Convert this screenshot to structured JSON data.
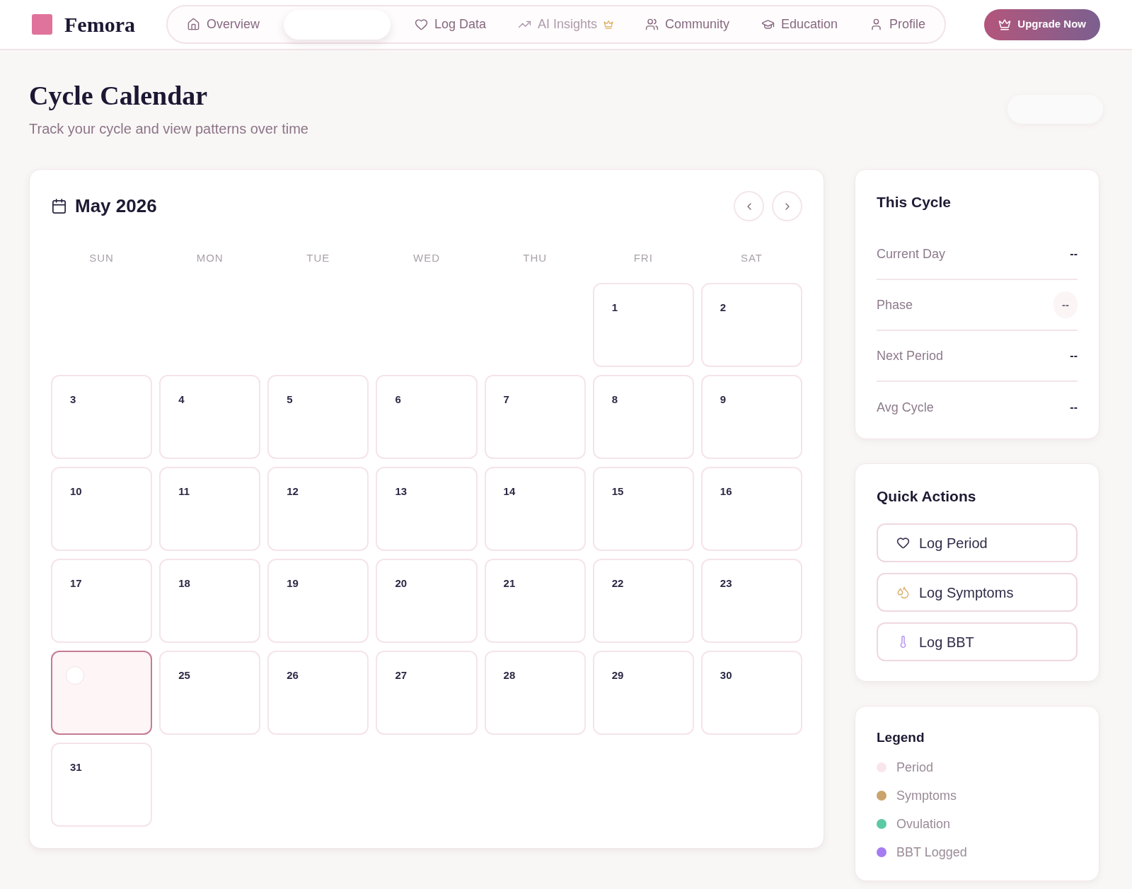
{
  "nav": {
    "logo": "Femora",
    "items": [
      {
        "label": "Overview",
        "selected": false,
        "premium": false
      },
      {
        "selected": true,
        "premium": false
      },
      {
        "label": "Log Data",
        "selected": false,
        "premium": false
      },
      {
        "label": "AI Insights",
        "selected": false,
        "premium": true
      },
      {
        "label": "Community",
        "selected": false,
        "premium": false
      },
      {
        "label": "Education",
        "selected": false,
        "premium": false
      },
      {
        "label": "Profile",
        "selected": false,
        "premium": false
      }
    ],
    "upgrade_button": "Upgrade Now"
  },
  "header": {
    "title": "Cycle Calendar",
    "subtitle": "Track your cycle and view patterns over time",
    "action": {
      "kind": "ghost"
    }
  },
  "calendar": {
    "month": "May 2026",
    "weekdays": [
      "SUN",
      "MON",
      "TUE",
      "WED",
      "THU",
      "FRI",
      "SAT"
    ],
    "weeks": [
      [
        {
          "kind": "blank"
        },
        {
          "kind": "blank"
        },
        {
          "kind": "blank"
        },
        {
          "kind": "blank"
        },
        {
          "kind": "blank"
        },
        {
          "kind": "day",
          "label": "1",
          "today": false
        },
        {
          "kind": "day",
          "label": "2",
          "today": false
        }
      ],
      [
        {
          "kind": "day",
          "label": "3",
          "today": false
        },
        {
          "kind": "day",
          "label": "4",
          "today": false
        },
        {
          "kind": "day",
          "label": "5",
          "today": false
        },
        {
          "kind": "day",
          "label": "6",
          "today": false
        },
        {
          "kind": "day",
          "label": "7",
          "today": false
        },
        {
          "kind": "day",
          "label": "8",
          "today": false
        },
        {
          "kind": "day",
          "label": "9",
          "today": false
        }
      ],
      [
        {
          "kind": "day",
          "label": "10",
          "today": false
        },
        {
          "kind": "day",
          "label": "11",
          "today": false
        },
        {
          "kind": "day",
          "label": "12",
          "today": false
        },
        {
          "kind": "day",
          "label": "13",
          "today": false
        },
        {
          "kind": "day",
          "label": "14",
          "today": false
        },
        {
          "kind": "day",
          "label": "15",
          "today": false
        },
        {
          "kind": "day",
          "label": "16",
          "today": false
        }
      ],
      [
        {
          "kind": "day",
          "label": "17",
          "today": false
        },
        {
          "kind": "day",
          "label": "18",
          "today": false
        },
        {
          "kind": "day",
          "label": "19",
          "today": false
        },
        {
          "kind": "day",
          "label": "20",
          "today": false
        },
        {
          "kind": "day",
          "label": "21",
          "today": false
        },
        {
          "kind": "day",
          "label": "22",
          "today": false
        },
        {
          "kind": "day",
          "label": "23",
          "today": false
        }
      ],
      [
        {
          "kind": "day",
          "today": true
        },
        {
          "kind": "day",
          "label": "25",
          "today": false
        },
        {
          "kind": "day",
          "label": "26",
          "today": false
        },
        {
          "kind": "day",
          "label": "27",
          "today": false
        },
        {
          "kind": "day",
          "label": "28",
          "today": false
        },
        {
          "kind": "day",
          "label": "29",
          "today": false
        },
        {
          "kind": "day",
          "label": "30",
          "today": false
        }
      ],
      [
        {
          "kind": "day",
          "label": "31",
          "today": false
        },
        {
          "kind": "blank"
        },
        {
          "kind": "blank"
        },
        {
          "kind": "blank"
        },
        {
          "kind": "blank"
        },
        {
          "kind": "blank"
        },
        {
          "kind": "blank"
        }
      ]
    ]
  },
  "this_cycle": {
    "title": "This Cycle",
    "rows": [
      {
        "label": "Current Day",
        "value": "--",
        "kind": "plain"
      },
      {
        "label": "Phase",
        "value": "--",
        "kind": "badge"
      },
      {
        "label": "Next Period",
        "value": "--",
        "kind": "plain"
      },
      {
        "label": "Avg Cycle",
        "value": "--",
        "kind": "plain"
      }
    ]
  },
  "quick_actions": {
    "title": "Quick Actions",
    "buttons": [
      "Log Period",
      "Log Symptoms",
      "Log BBT"
    ]
  },
  "legend": {
    "title": "Legend",
    "items": [
      {
        "label": "Period",
        "color": "#f9e6eb"
      },
      {
        "label": "Symptoms",
        "color": "#c9a46c"
      },
      {
        "label": "Ovulation",
        "color": "#5cc8a6"
      },
      {
        "label": "BBT Logged",
        "color": "#a67cf2"
      }
    ]
  }
}
